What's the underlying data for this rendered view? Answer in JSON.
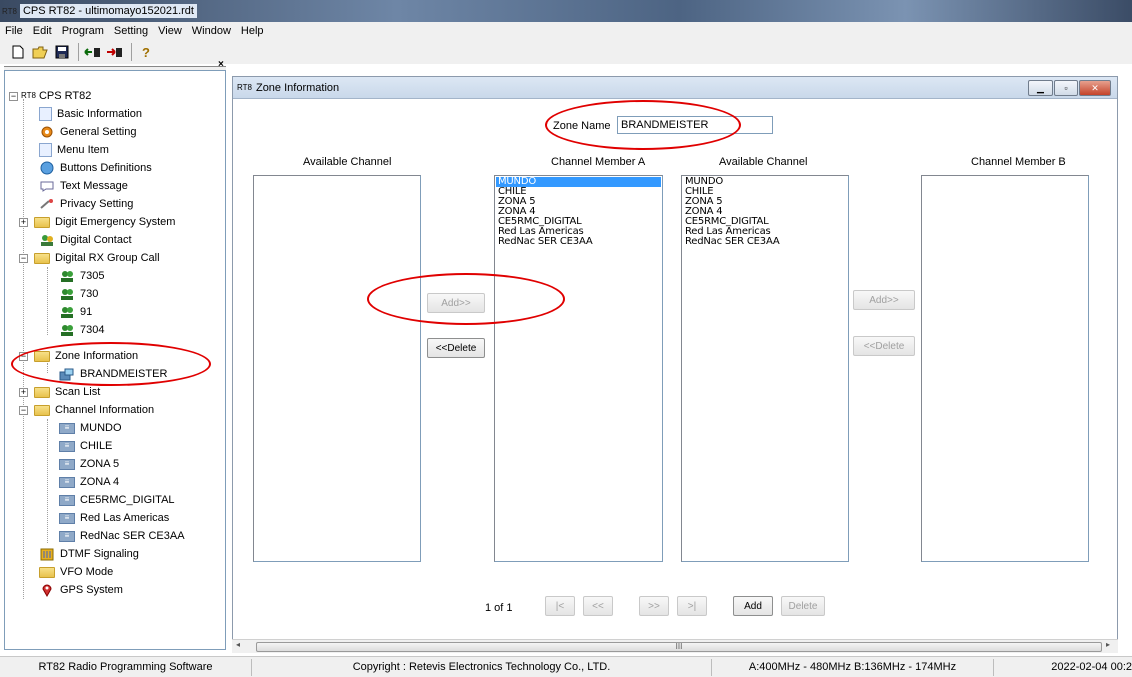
{
  "window": {
    "app_icon": "RT8",
    "title": "CPS RT82 - ultimomayo152021.rdt"
  },
  "menu": [
    "File",
    "Edit",
    "Program",
    "Setting",
    "View",
    "Window",
    "Help"
  ],
  "toolbar": {
    "icons": [
      "new-file-icon",
      "open-folder-icon",
      "save-disk-icon",
      "read-radio-icon",
      "write-radio-icon",
      "help-icon"
    ]
  },
  "tree": {
    "root": "CPS RT82",
    "items": {
      "basic_information": "Basic Information",
      "general_setting": "General Setting",
      "menu_item": "Menu Item",
      "buttons_definitions": "Buttons Definitions",
      "text_message": "Text Message",
      "privacy_setting": "Privacy Setting",
      "digit_emergency_system": "Digit Emergency System",
      "digital_contact": "Digital Contact",
      "digital_rx_group_call": "Digital RX Group Call",
      "group_7305": "7305",
      "group_730": "730",
      "group_91": "91",
      "group_7304": "7304",
      "zone_information": "Zone Information",
      "zone_brandmeister": "BRANDMEISTER",
      "scan_list": "Scan List",
      "channel_information": "Channel Information",
      "ch_mundo": "MUNDO",
      "ch_chile": "CHILE",
      "ch_zona5": "ZONA 5",
      "ch_zona4": "ZONA 4",
      "ch_ce5rmc": "CE5RMC_DIGITAL",
      "ch_red_las_americas": "Red Las Americas",
      "ch_rednac": "RedNac SER CE3AA",
      "dtmf_signaling": "DTMF Signaling",
      "vfo_mode": "VFO Mode",
      "gps_system": "GPS System"
    }
  },
  "zone_window": {
    "title": "Zone Information",
    "zone_name_label": "Zone Name",
    "zone_name_value": "BRANDMEISTER",
    "available_channel_label_a": "Available Channel",
    "channel_member_a_label": "Channel Member A",
    "available_channel_label_b": "Available Channel",
    "channel_member_b_label": "Channel Member B",
    "channel_member_a": [
      "MUNDO",
      "CHILE",
      "ZONA 5",
      "ZONA 4",
      "CE5RMC_DIGITAL",
      "Red Las Americas",
      "RedNac SER CE3AA"
    ],
    "available_channel_b": [
      "MUNDO",
      "CHILE",
      "ZONA 5",
      "ZONA 4",
      "CE5RMC_DIGITAL",
      "Red Las Americas",
      "RedNac SER CE3AA"
    ],
    "add_label": "Add>>",
    "delete_label": "<<Delete",
    "add_label_b": "Add>>",
    "delete_label_b": "<<Delete",
    "page_indicator": "1 of 1",
    "nav_first": "|<",
    "nav_prev": "<<",
    "nav_next": ">>",
    "nav_last": ">|",
    "add_zone": "Add",
    "delete_zone": "Delete",
    "scroll_grip": "III"
  },
  "statusbar": {
    "software": "RT82 Radio Programming Software",
    "copyright": "Copyright : Retevis Electronics Technology Co., LTD.",
    "band": "A:400MHz - 480MHz B:136MHz - 174MHz",
    "datetime": "2022-02-04 00:2"
  },
  "colors": {
    "annotation": "#e00000",
    "selection": "#3399ff"
  }
}
